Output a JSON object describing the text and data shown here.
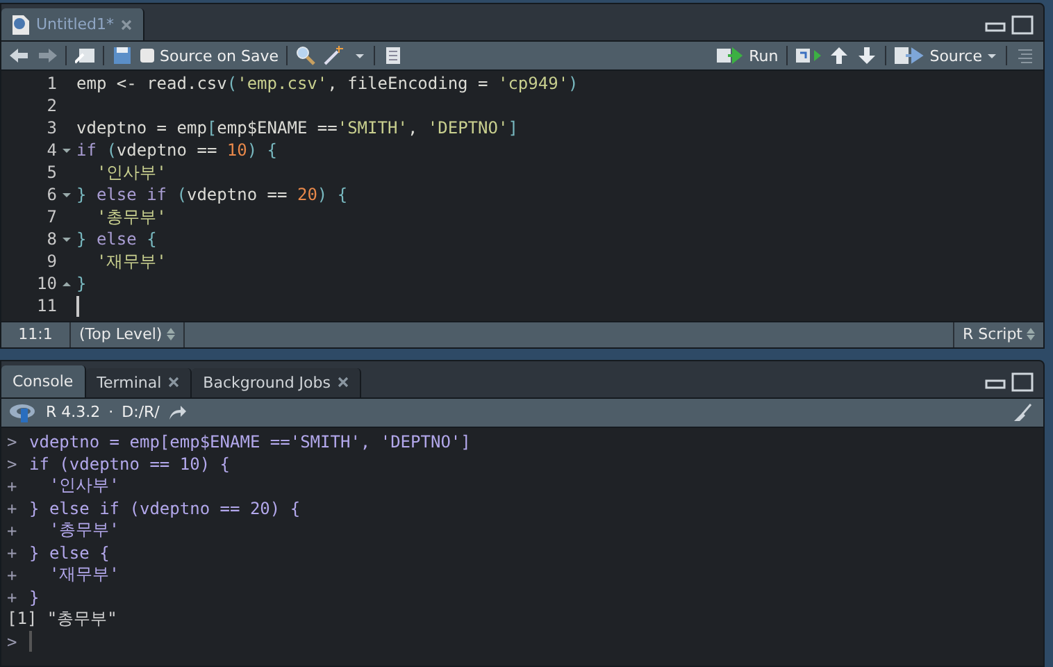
{
  "editor": {
    "tabs": [
      {
        "label": "Untitled1*",
        "selected": true
      }
    ],
    "toolbar": {
      "source_on_save": {
        "label": "Source on Save",
        "checked": false
      },
      "run_label": "Run",
      "source_label": "Source"
    },
    "lines": [
      {
        "number": "1",
        "cursor": false,
        "tokens": [
          {
            "kind": "id",
            "text": "emp <- read.csv"
          },
          {
            "kind": "punct",
            "text": "("
          },
          {
            "kind": "str",
            "text": "'emp.csv'"
          },
          {
            "kind": "id",
            "text": ", fileEncoding = "
          },
          {
            "kind": "str",
            "text": "'cp949'"
          },
          {
            "kind": "punct",
            "text": ")"
          }
        ]
      },
      {
        "number": "2",
        "cursor": false
      },
      {
        "number": "3",
        "cursor": false,
        "tokens": [
          {
            "kind": "id",
            "text": "vdeptno = emp"
          },
          {
            "kind": "punct",
            "text": "["
          },
          {
            "kind": "id",
            "text": "emp$ENAME =="
          },
          {
            "kind": "str",
            "text": "'SMITH'"
          },
          {
            "kind": "id",
            "text": ", "
          },
          {
            "kind": "str",
            "text": "'DEPTNO'"
          },
          {
            "kind": "punct",
            "text": "]"
          }
        ]
      },
      {
        "number": "4",
        "cursor": false,
        "kind": "fold_start",
        "tokens": [
          {
            "kind": "kw",
            "text": "if "
          },
          {
            "kind": "punct",
            "text": "("
          },
          {
            "kind": "id",
            "text": "vdeptno == "
          },
          {
            "kind": "num",
            "text": "10"
          },
          {
            "kind": "punct",
            "text": ") {"
          }
        ]
      },
      {
        "number": "5",
        "cursor": false,
        "tokens": [
          {
            "kind": "str",
            "text": "  '인사부'"
          }
        ]
      },
      {
        "number": "6",
        "cursor": false,
        "kind": "fold_start",
        "tokens": [
          {
            "kind": "punct",
            "text": "} "
          },
          {
            "kind": "kw",
            "text": "else if "
          },
          {
            "kind": "punct",
            "text": "("
          },
          {
            "kind": "id",
            "text": "vdeptno == "
          },
          {
            "kind": "num",
            "text": "20"
          },
          {
            "kind": "punct",
            "text": ") {"
          }
        ]
      },
      {
        "number": "7",
        "cursor": false,
        "tokens": [
          {
            "kind": "str",
            "text": "  '총무부'"
          }
        ]
      },
      {
        "number": "8",
        "cursor": false,
        "kind": "fold_start",
        "tokens": [
          {
            "kind": "punct",
            "text": "} "
          },
          {
            "kind": "kw",
            "text": "else "
          },
          {
            "kind": "punct",
            "text": "{"
          }
        ]
      },
      {
        "number": "9",
        "cursor": false,
        "tokens": [
          {
            "kind": "str",
            "text": "  '재무부'"
          }
        ]
      },
      {
        "number": "10",
        "cursor": false,
        "kind": "fold_end",
        "tokens": [
          {
            "kind": "punct",
            "text": "}"
          }
        ]
      },
      {
        "number": "11",
        "cursor": true
      }
    ],
    "status": {
      "position": "11:1",
      "scope": "(Top Level)",
      "file_type": "R Script"
    }
  },
  "console": {
    "tabs": [
      {
        "label": "Console",
        "selected": true,
        "closable": false
      },
      {
        "label": "Terminal",
        "selected": false,
        "closable": true
      },
      {
        "label": "Background Jobs",
        "selected": false,
        "closable": true
      }
    ],
    "version": "R 4.3.2",
    "separator": "·",
    "path": "D:/R/",
    "lines": [
      {
        "kind": "input",
        "prompt": ">",
        "text": "vdeptno = emp[emp$ENAME =='SMITH', 'DEPTNO']"
      },
      {
        "kind": "input",
        "prompt": ">",
        "text": "if (vdeptno == 10) {"
      },
      {
        "kind": "input",
        "prompt": "+",
        "text": "  '인사부'"
      },
      {
        "kind": "input",
        "prompt": "+",
        "text": "} else if (vdeptno == 20) {"
      },
      {
        "kind": "input",
        "prompt": "+",
        "text": "  '총무부'"
      },
      {
        "kind": "input",
        "prompt": "+",
        "text": "} else {"
      },
      {
        "kind": "input",
        "prompt": "+",
        "text": "  '재무부'"
      },
      {
        "kind": "input",
        "prompt": "+",
        "text": "}"
      },
      {
        "kind": "output",
        "text": "[1] \"총무부\""
      },
      {
        "kind": "prompt",
        "prompt": ">"
      }
    ]
  }
}
